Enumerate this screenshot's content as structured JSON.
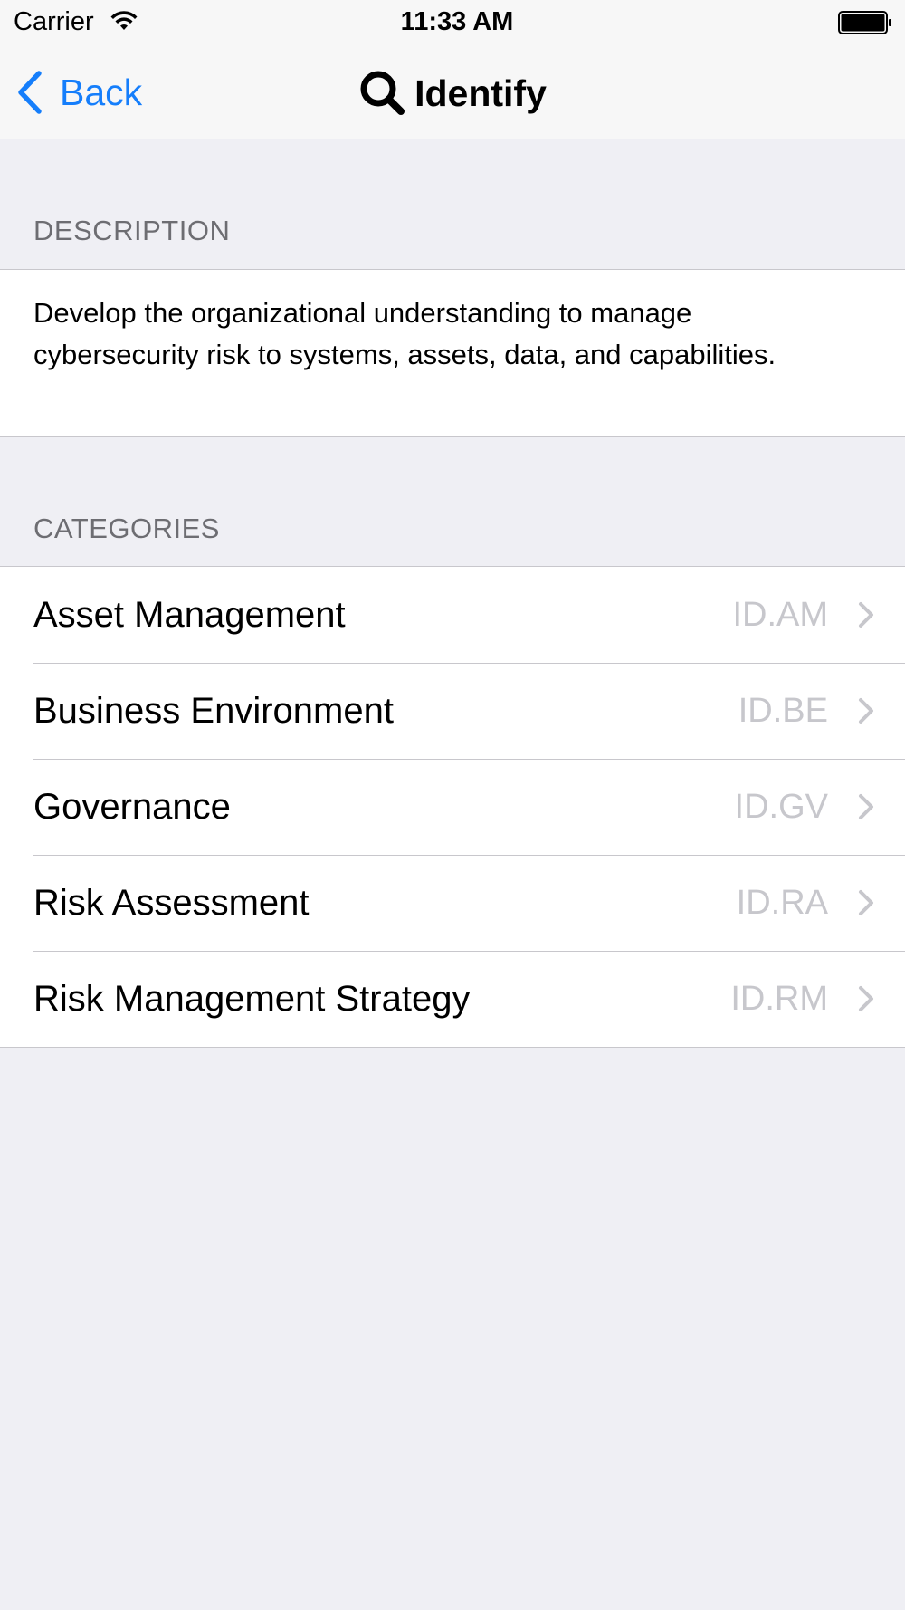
{
  "status_bar": {
    "carrier": "Carrier",
    "time": "11:33 AM"
  },
  "nav": {
    "back_label": "Back",
    "title": "Identify",
    "title_icon": "search-icon",
    "accent_color": "#157efb"
  },
  "description": {
    "header": "DESCRIPTION",
    "text": "Develop the organizational understanding to manage cybersecurity risk to systems, assets, data, and capabilities."
  },
  "categories": {
    "header": "CATEGORIES",
    "items": [
      {
        "label": "Asset Management",
        "code": "ID.AM"
      },
      {
        "label": "Business Environment",
        "code": "ID.BE"
      },
      {
        "label": "Governance",
        "code": "ID.GV"
      },
      {
        "label": "Risk Assessment",
        "code": "ID.RA"
      },
      {
        "label": "Risk Management Strategy",
        "code": "ID.RM"
      }
    ]
  }
}
